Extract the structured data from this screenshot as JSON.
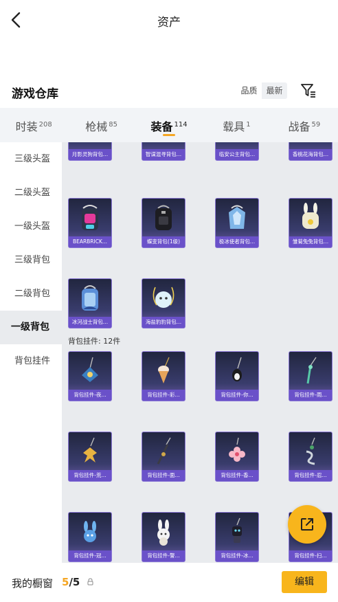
{
  "header": {
    "title": "资产"
  },
  "warehouse": {
    "title": "游戏仓库",
    "sort": [
      "品质",
      "最新"
    ]
  },
  "tabs": [
    {
      "label": "时装",
      "count": "208"
    },
    {
      "label": "枪械",
      "count": "85"
    },
    {
      "label": "装备",
      "count": "114"
    },
    {
      "label": "载具",
      "count": "1"
    },
    {
      "label": "战备",
      "count": "59"
    }
  ],
  "sidebar": [
    {
      "label": "三级头盔"
    },
    {
      "label": "二级头盔"
    },
    {
      "label": "一级头盔"
    },
    {
      "label": "三级背包"
    },
    {
      "label": "二级背包"
    },
    {
      "label": "一级背包"
    },
    {
      "label": "背包挂件"
    }
  ],
  "backpacks": [
    {
      "label": "月影灵狗背包..."
    },
    {
      "label": "智谋混寻背包..."
    },
    {
      "label": "临安公主背包..."
    },
    {
      "label": "香桃花海背包..."
    },
    {
      "label": "BEARBRICK..."
    },
    {
      "label": "蝶变背包(1级)"
    },
    {
      "label": "极冰使者背包..."
    },
    {
      "label": "雏菊兔兔背包..."
    },
    {
      "label": "冰河战士背包..."
    },
    {
      "label": "海盐豹豹背包..."
    }
  ],
  "pendant_section": {
    "header": "背包挂件: 12件"
  },
  "pendants": [
    {
      "label": "背包挂件-夜..."
    },
    {
      "label": "背包挂件-彩..."
    },
    {
      "label": "背包挂件-你..."
    },
    {
      "label": "背包挂件-雨..."
    },
    {
      "label": "背包挂件-荒..."
    },
    {
      "label": "背包挂件-面..."
    },
    {
      "label": "背包挂件-香..."
    },
    {
      "label": "背包挂件-忍..."
    },
    {
      "label": "背包挂件-冠..."
    },
    {
      "label": "背包挂件-警..."
    },
    {
      "label": "背包挂件-冰..."
    },
    {
      "label": "背包挂件-扫..."
    }
  ],
  "bottom": {
    "window_label": "我的橱窗",
    "current": "5",
    "total": "/5",
    "edit": "编辑"
  },
  "colors": {
    "accent": "#f8b51c",
    "card_label": "#6a51c9"
  }
}
